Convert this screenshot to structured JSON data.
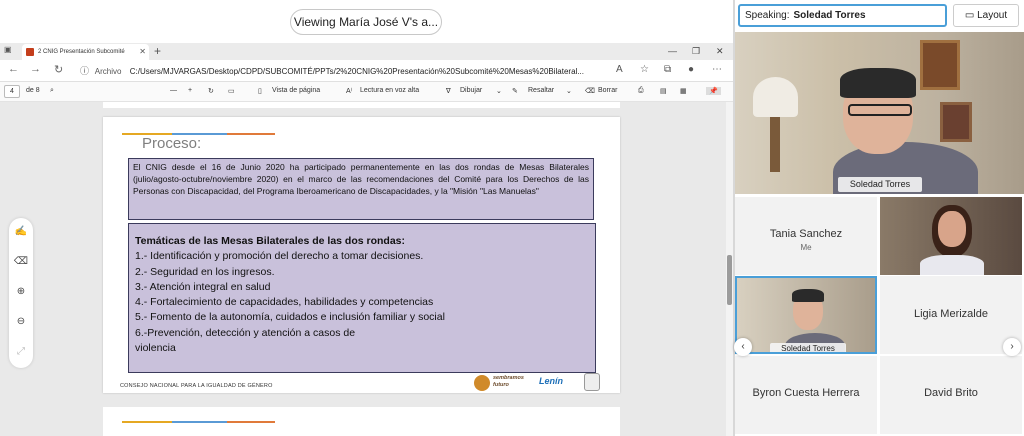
{
  "meeting": {
    "viewing": "Viewing María José V's a..."
  },
  "browser": {
    "tab_title": "2 CNIG Presentación Subcomité",
    "url_label": "Archivo",
    "url": "C:/Users/MJVARGAS/Desktop/CDPD/SUBCOMITÉ/PPTs/2%20CNIG%20Presentación%20Subcomité%20Mesas%20Bilateral..."
  },
  "pdf_toolbar": {
    "page_current": "4",
    "page_total": "de 8",
    "page_view": "Vista de página",
    "read_aloud": "Lectura en voz alta",
    "draw": "Dibujar",
    "highlight": "Resaltar",
    "erase": "Borrar"
  },
  "slide": {
    "title": "Proceso:",
    "intro": "El CNIG desde el 16 de Junio 2020 ha participado permanentemente en las dos rondas de Mesas Bilaterales (julio/agosto-octubre/noviembre 2020) en el marco de las  recomendaciones del Comité para los Derechos de las Personas con Discapacidad, del Programa Iberoamericano de Discapacidades, y la \"Misión \"Las Manuelas\"",
    "topics_heading": "Temáticas de las Mesas Bilaterales de las dos rondas:",
    "topics": [
      "1.-  Identificación y promoción del derecho a tomar decisiones.",
      "2.- Seguridad en los ingresos.",
      "3.- Atención integral en salud",
      "4.- Fortalecimiento de capacidades, habilidades y competencias",
      "5.- Fomento de la autonomía, cuidados e inclusión familiar y social",
      "6.-Prevención, detección y atención a casos de",
      "violencia"
    ],
    "footer": "CONSEJO NACIONAL PARA LA IGUALDAD DE GÉNERO",
    "logo1": "sembramos futuro",
    "logo2": "Lenín"
  },
  "panel": {
    "speaking_label": "Speaking:",
    "speaking_name": "Soledad Torres",
    "layout_label": "Layout",
    "main_name": "Soledad Torres",
    "participants": [
      {
        "name": "Tania Sanchez",
        "sub": "Me"
      },
      {
        "name": "Ligia Merizalde"
      },
      {
        "name": "Soledad Torres"
      },
      {
        "name": "Byron Cuesta Herrera"
      },
      {
        "name": "David Brito"
      }
    ]
  },
  "colors": {
    "slide_box": "#c9c1db",
    "speaker_border": "#4a9fd8"
  }
}
